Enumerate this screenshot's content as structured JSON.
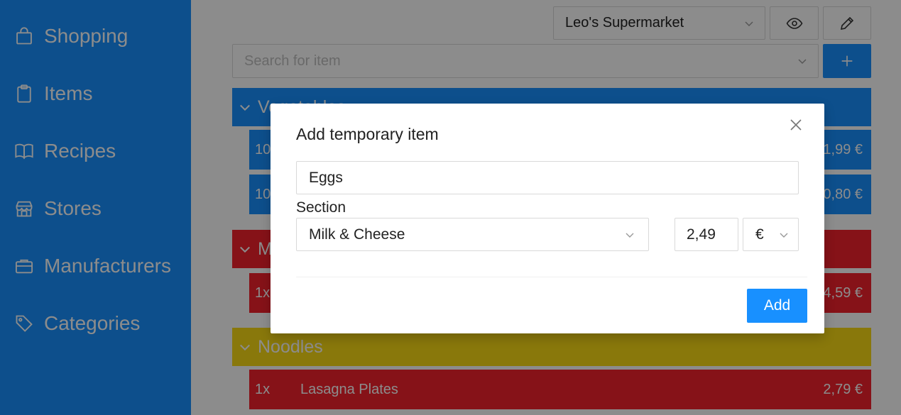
{
  "sidebar": {
    "items": [
      {
        "label": "Shopping",
        "icon": "shopping-bag-icon"
      },
      {
        "label": "Items",
        "icon": "clipboard-icon"
      },
      {
        "label": "Recipes",
        "icon": "book-icon"
      },
      {
        "label": "Stores",
        "icon": "shop-icon"
      },
      {
        "label": "Manufacturers",
        "icon": "briefcase-icon"
      },
      {
        "label": "Categories",
        "icon": "tag-icon"
      }
    ]
  },
  "toolbar": {
    "store_select": "Leo's Supermarket",
    "view_icon": "eye-icon",
    "edit_icon": "edit-icon",
    "search_placeholder": "Search for item",
    "add_icon": "plus-icon"
  },
  "list": {
    "sections": [
      {
        "name": "Vegetables",
        "color": "#1890ff",
        "items": [
          {
            "qty": "10",
            "name": "",
            "price": "1,99 €"
          },
          {
            "qty": "10",
            "name": "",
            "price": "0,80 €"
          }
        ]
      },
      {
        "name": "M",
        "color": "#f5222d",
        "items": [
          {
            "qty": "1x",
            "name": "",
            "price": "4,59 €"
          }
        ]
      },
      {
        "name": "Noodles",
        "color": "#fadb14",
        "items": [
          {
            "qty": "1x",
            "name": "Lasagna Plates",
            "price": "2,79 €"
          }
        ]
      }
    ]
  },
  "modal": {
    "title": "Add temporary item",
    "close_icon": "close-icon",
    "item_name_value": "Eggs",
    "section_label": "Section",
    "section_value": "Milk & Cheese",
    "price_value": "2,49",
    "currency_value": "€",
    "add_label": "Add"
  },
  "colors": {
    "accent": "#1890ff",
    "red": "#f5222d",
    "yellow": "#fadb14"
  }
}
